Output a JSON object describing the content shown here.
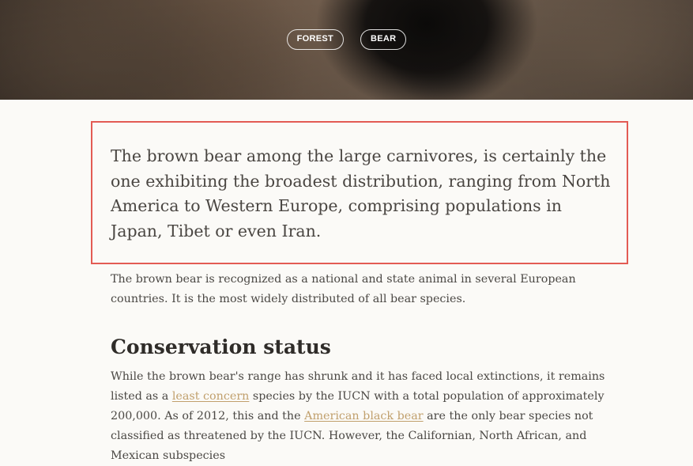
{
  "hero": {
    "tags": [
      "FOREST",
      "BEAR"
    ]
  },
  "article": {
    "lead": "The brown bear among the large carnivores, is certainly the one exhibiting the broadest distribution, ranging from North America to Western Europe, comprising populations in Japan, Tibet or even Iran.",
    "paragraph1": "The brown bear is recognized as a national and state animal in several European countries. It is the most widely distributed of all bear species.",
    "section_heading": "Conservation status",
    "paragraph2": {
      "part1": "While the brown bear's range has shrunk and it has faced local extinctions, it remains listed as a ",
      "link1": "least concern",
      "part2": " species by the IUCN with a total population of approximately 200,000. As of 2012, this and the ",
      "link2": "American black bear",
      "part3": " are the only bear species not classified as threatened by the IUCN. However, the Californian, North African, and Mexican subspecies"
    }
  },
  "colors": {
    "highlight_border": "#e35b54",
    "link": "#c1a06d",
    "background": "#fbfaf7"
  }
}
